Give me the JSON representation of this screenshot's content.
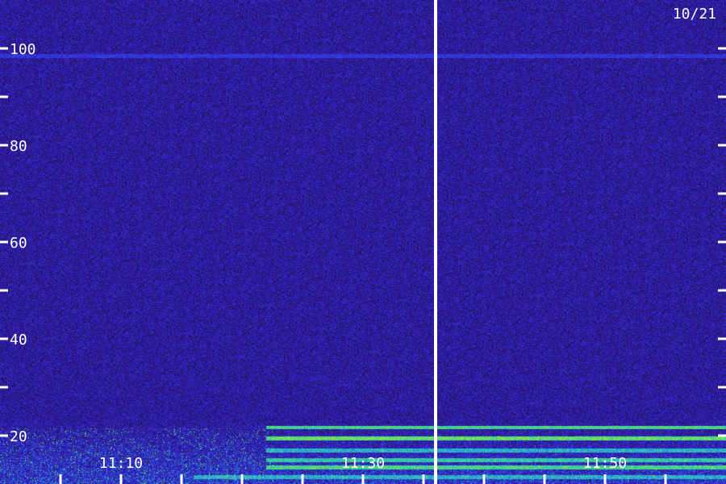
{
  "date_label": "10/21",
  "colors": {
    "background_low": "#1a0a4a",
    "noise_mid": "#3a1fd8",
    "signal_high": "#f2f20a",
    "axis": "#ffffff"
  },
  "chart_data": {
    "type": "heatmap",
    "title": "",
    "xlabel": "",
    "ylabel": "",
    "y_range": [
      10,
      110
    ],
    "y_ticks": [
      100,
      80,
      60,
      40,
      20
    ],
    "y_tick_labels": [
      "100",
      "80",
      "60",
      "40",
      "20"
    ],
    "y_minor_ticks": [
      100,
      90,
      80,
      70,
      60,
      50,
      40,
      30,
      20
    ],
    "x_range_minutes": [
      0,
      60
    ],
    "x_ticks_minutes": [
      10,
      30,
      50
    ],
    "x_tick_labels": [
      "11:10",
      "11:30",
      "11:50"
    ],
    "x_minor_ticks_minutes": [
      5,
      10,
      15,
      20,
      25,
      30,
      35,
      40,
      45,
      50,
      55
    ],
    "marker_line_minutes": 36,
    "features": [
      {
        "y": 98.5,
        "intensity": 0.55,
        "from_minutes": 0,
        "to_minutes": 60
      },
      {
        "y": 21.8,
        "intensity": 0.9,
        "from_minutes": 22,
        "to_minutes": 60
      },
      {
        "y": 19.5,
        "intensity": 0.95,
        "from_minutes": 22,
        "to_minutes": 60
      },
      {
        "y": 17.0,
        "intensity": 0.8,
        "from_minutes": 22,
        "to_minutes": 60
      },
      {
        "y": 15.0,
        "intensity": 0.85,
        "from_minutes": 22,
        "to_minutes": 60
      },
      {
        "y": 13.5,
        "intensity": 0.9,
        "from_minutes": 22,
        "to_minutes": 60
      },
      {
        "y": 11.5,
        "intensity": 0.8,
        "from_minutes": 16,
        "to_minutes": 60
      },
      {
        "y": 32.0,
        "intensity": 0.35,
        "from_minutes": 24,
        "to_minutes": 27
      },
      {
        "y": 32.0,
        "intensity": 0.35,
        "from_minutes": 13,
        "to_minutes": 15
      }
    ]
  }
}
